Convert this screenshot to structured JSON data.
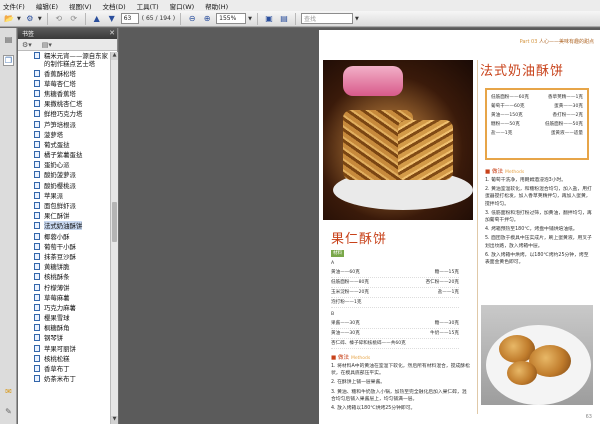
{
  "menu": [
    "文件(F)",
    "编辑(E)",
    "视图(V)",
    "文档(D)",
    "工具(T)",
    "窗口(W)",
    "帮助(H)"
  ],
  "toolbar": {
    "page_value": "63",
    "page_total": "( 65 / 194 )",
    "zoom_value": "155%",
    "search_placeholder": "查找"
  },
  "panel": {
    "title": "书签"
  },
  "bookmarks": [
    "糯米元宵——源自东家的制作糕点艺士塔",
    "香蕉酥松塔",
    "草莓杏仁塔",
    "焦糖香蕉塔",
    "果撒桃杏仁塔",
    "鲜橙巧克力塔",
    "芦笋培根派",
    "菠萝塔",
    "葡式蛋挞",
    "橘子紫薯蛋挞",
    "蛋奶心派",
    "酸奶菠萝派",
    "酸奶樱桃派",
    "苹果派",
    "面包鲜虾派",
    "果仁酥饼",
    "法式奶油酥饼",
    "椰蓉小酥",
    "葡萄干小酥",
    "抹茶豆沙酥",
    "黄糖饼脆",
    "核桃酥条",
    "柠檬薄饼",
    "草莓麻薯",
    "巧克力麻薯",
    "樱果雪球",
    "枫糖酥角",
    "钢琴饼",
    "苹果可丽饼",
    "核桃松糕",
    "香草布丁",
    "奶茶米布丁"
  ],
  "selected_bookmark": "法式奶油酥饼",
  "page": {
    "running_head": "Part 03",
    "running_head_sub": "人心——美味有趣的甜点",
    "title_right": "法式奶油酥饼",
    "ingredients_right": [
      [
        "低筋面粉",
        "60克",
        "香草荚精",
        "1克"
      ],
      [
        "葡萄干",
        "60克",
        "蛋黄",
        "30克"
      ],
      [
        "黄油",
        "150克",
        "香打粉",
        "2克"
      ],
      [
        "糖粉",
        "50克",
        "低筋面粉",
        "50克"
      ],
      [
        "盐",
        "1克",
        "蛋黄液",
        "适量"
      ]
    ],
    "method_label": "做法",
    "method_en": "Methods",
    "steps_right": [
      "1. 葡萄干洗净，用朗姆酒浸泡3小时。",
      "2. 黄油室温软化，和糖粉混合均匀，加入盐，用打蛋器搅打松发，加入香草荚精拌匀，再加入蛋黄，搅拌均匀。",
      "3. 低筋面粉和泡打粉过筛，加黄油，翻拌均匀，再加葡萄干拌匀。",
      "4. 烤箱预热至180℃，烤盘中铺烘焙油纸。",
      "5. 面团放于模具中压实成片，刷上蛋黄液，用叉子划出纹路，放入烤箱中层。",
      "6. 放入烤箱中烘烤，以180℃烤约25分钟，烤至表面金黄色即可。"
    ],
    "title_left": "果仁酥饼",
    "material_label": "材料",
    "group_a": "A",
    "ingredients_left_a": [
      [
        "黄油",
        "60克",
        "糖",
        "15克"
      ],
      [
        "低筋面粉",
        "80克",
        "杏仁粉",
        "20克"
      ],
      [
        "玉米淀粉",
        "20克",
        "盐",
        "1克"
      ],
      [
        "泡打粉",
        "1克",
        "",
        ""
      ]
    ],
    "group_b": "B",
    "ingredients_left_b": [
      [
        "果酱",
        "30克",
        "糖",
        "30克"
      ],
      [
        "黄油",
        "30克",
        "牛奶",
        "15克"
      ],
      [
        "杏仁碎、榛子碎和核桃碎",
        "共60克",
        "",
        ""
      ]
    ],
    "steps_left": [
      "1. 将材料A中的黄油在室温下软化，然后所有材料混合，搅成酥松状，在模具底部压平实。",
      "2. 在酥饼上铺一层果酱。",
      "3. 黄油、糖和牛奶放入小锅，加热至完全融化后加入果仁碎，混合均匀后铺入果酱层上，均匀铺满一层。",
      "4. 放入烤箱以180℃烘烤25分钟即可。"
    ],
    "page_number": "63"
  }
}
